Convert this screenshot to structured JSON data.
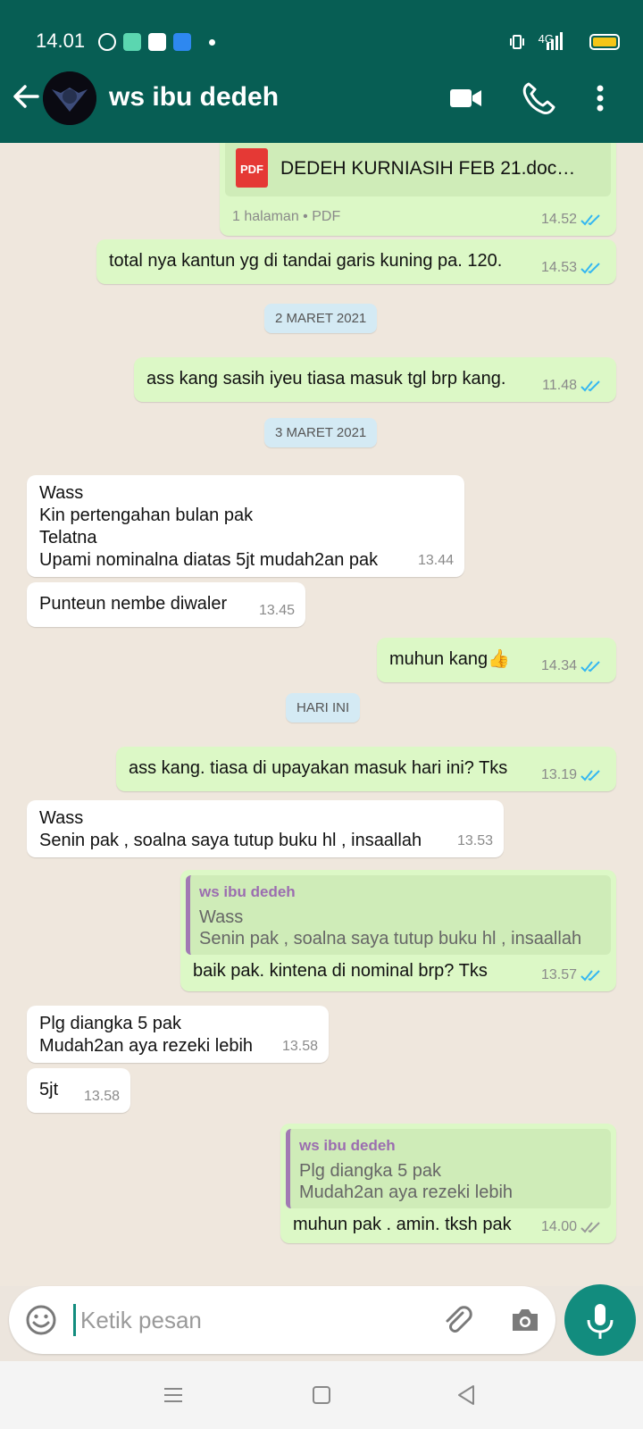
{
  "status_bar": {
    "time": "14.01",
    "network": "4G"
  },
  "app_bar": {
    "contact_name": "ws ibu dedeh"
  },
  "messages": {
    "m1": {
      "doc_name": "DEDEH KURNIASIH FEB 21.doc…",
      "doc_sub": "1 halaman • PDF",
      "pdf_label": "PDF",
      "time": "14.52"
    },
    "m2": {
      "text": "total nya kantun yg di tandai garis kuning pa. 120.",
      "time": "14.53"
    },
    "d1": {
      "text": "2 MARET 2021"
    },
    "m3": {
      "text": "ass kang sasih iyeu tiasa masuk tgl brp kang.",
      "time": "11.48"
    },
    "d2": {
      "text": "3 MARET 2021"
    },
    "m4": {
      "lines": [
        "Wass",
        "Kin pertengahan bulan pak",
        "Telatna",
        "Upami nominalna diatas 5jt mudah2an pak"
      ],
      "time": "13.44"
    },
    "m5": {
      "text": "Punteun nembe diwaler",
      "time": "13.45"
    },
    "m6": {
      "text": "muhun kang",
      "emoji": "👍",
      "time": "14.34"
    },
    "d3": {
      "text": "HARI INI"
    },
    "m7": {
      "text": "ass kang. tiasa di upayakan masuk hari ini? Tks",
      "time": "13.19"
    },
    "m8": {
      "lines": [
        "Wass",
        "Senin pak , soalna saya tutup buku hl , insaallah"
      ],
      "time": "13.53"
    },
    "m9": {
      "quote_name": "ws ibu dedeh",
      "quote_lines": [
        "Wass",
        "Senin pak , soalna saya tutup buku hl , insaallah"
      ],
      "text": "baik pak. kintena di nominal brp? Tks",
      "time": "13.57"
    },
    "m10": {
      "lines": [
        "Plg diangka 5 pak",
        "Mudah2an aya rezeki lebih"
      ],
      "time": "13.58"
    },
    "m11": {
      "text": "5jt",
      "time": "13.58"
    },
    "m12": {
      "quote_name": "ws ibu dedeh",
      "quote_lines": [
        "Plg diangka 5 pak",
        "Mudah2an aya rezeki lebih"
      ],
      "text": "muhun pak . amin. tksh pak",
      "time": "14.00"
    }
  },
  "input": {
    "placeholder": "Ketik pesan"
  },
  "colors": {
    "header": "#075e54",
    "outgoing": "#dcf8c6",
    "incoming": "#ffffff",
    "accent": "#128c7e",
    "read_ticks": "#34b7f1"
  }
}
